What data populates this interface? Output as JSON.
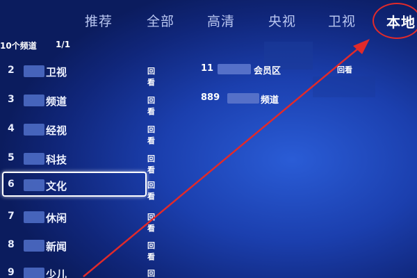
{
  "nav": {
    "tabs": [
      {
        "label": "推荐"
      },
      {
        "label": "全部"
      },
      {
        "label": "高清"
      },
      {
        "label": "央视"
      },
      {
        "label": "卫视"
      },
      {
        "label": "本地"
      }
    ],
    "active_tab": "本地"
  },
  "list": {
    "header": "10个频道",
    "page": "1/1"
  },
  "channels": [
    {
      "number": "2",
      "name": "卫视",
      "replay": "回看"
    },
    {
      "number": "3",
      "name": "频道",
      "replay": "回看"
    },
    {
      "number": "4",
      "name": "经视",
      "replay": "回看"
    },
    {
      "number": "5",
      "name": "科技",
      "replay": "回看"
    },
    {
      "number": "6",
      "name": "文化",
      "replay": "回看"
    },
    {
      "number": "7",
      "name": "休闲",
      "replay": "回看"
    },
    {
      "number": "8",
      "name": "新闻",
      "replay": "回看"
    },
    {
      "number": "9",
      "name": "少儿",
      "replay": "回看"
    }
  ],
  "selected_channel_index": 4,
  "programs": [
    {
      "number": "11",
      "title": "会员区",
      "replay": "回看"
    },
    {
      "number": "889",
      "title": "频道",
      "replay": ""
    }
  ],
  "colors": {
    "annotation": "#e12a2a",
    "background": "#1b3fae"
  }
}
